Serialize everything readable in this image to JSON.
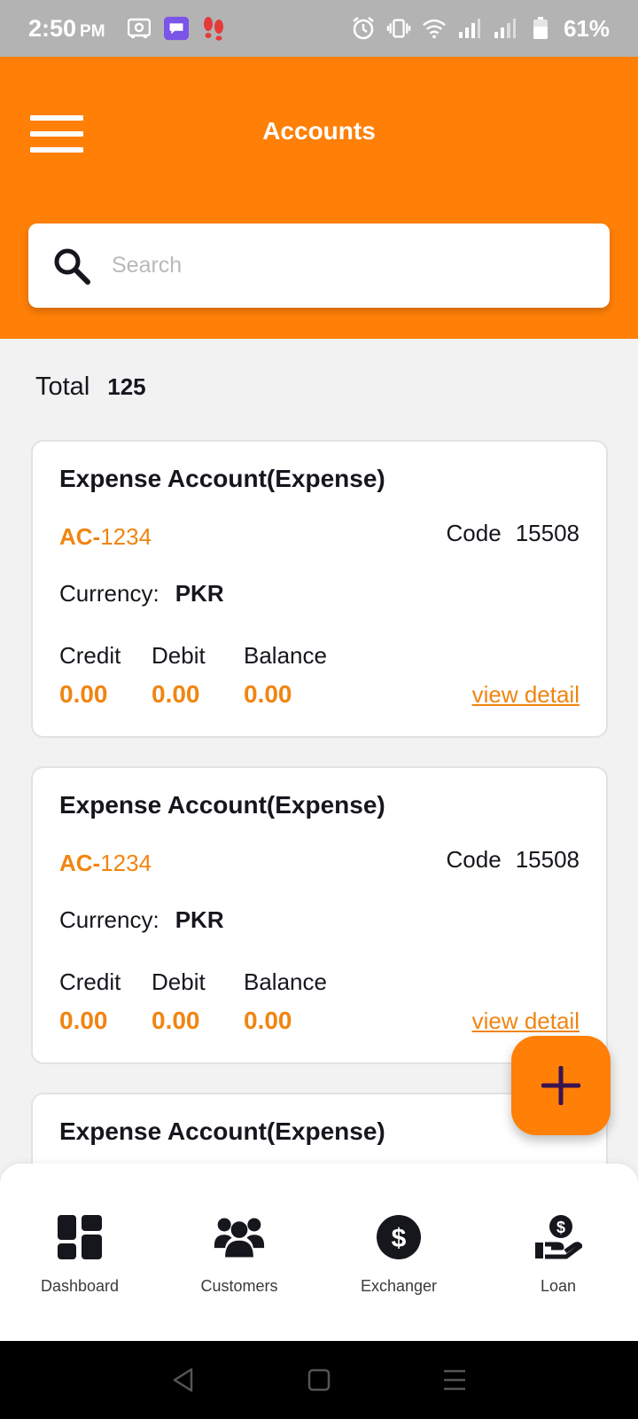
{
  "status_bar": {
    "time": "2:50",
    "ampm": "PM",
    "battery": "61%",
    "icons": [
      "cloud-save-icon",
      "chat-app-icon",
      "footsteps-icon",
      "alarm-icon",
      "vibrate-icon",
      "wifi-icon",
      "signal-icon",
      "signal-icon",
      "battery-icon"
    ]
  },
  "header": {
    "title": "Accounts",
    "menu_icon": "hamburger-menu-icon",
    "color": "#ff7f07"
  },
  "search": {
    "placeholder": "Search",
    "value": "",
    "icon": "search-icon"
  },
  "summary": {
    "total_label": "Total",
    "total_value": "125"
  },
  "accounts": [
    {
      "title": "Expense Account(Expense)",
      "ac_prefix": "AC-",
      "ac_number": "1234",
      "code_label": "Code",
      "code_value": "15508",
      "currency_label": "Currency:",
      "currency_value": "PKR",
      "credit_label": "Credit",
      "credit_value": "0.00",
      "debit_label": "Debit",
      "debit_value": "0.00",
      "balance_label": "Balance",
      "balance_value": "0.00",
      "link_label": "view detail"
    },
    {
      "title": "Expense Account(Expense)",
      "ac_prefix": "AC-",
      "ac_number": "1234",
      "code_label": "Code",
      "code_value": "15508",
      "currency_label": "Currency:",
      "currency_value": "PKR",
      "credit_label": "Credit",
      "credit_value": "0.00",
      "debit_label": "Debit",
      "debit_value": "0.00",
      "balance_label": "Balance",
      "balance_value": "0.00",
      "link_label": "view detail"
    },
    {
      "title": "Expense Account(Expense)"
    }
  ],
  "fab": {
    "icon": "plus-icon",
    "icon_color": "#3a1450"
  },
  "bottom_nav": [
    {
      "label": "Dashboard",
      "icon": "dashboard-icon"
    },
    {
      "label": "Customers",
      "icon": "customers-icon"
    },
    {
      "label": "Exchanger",
      "icon": "dollar-icon"
    },
    {
      "label": "Loan",
      "icon": "loan-icon"
    }
  ],
  "system_nav": [
    "back-icon",
    "home-icon",
    "recents-icon"
  ],
  "colors": {
    "accent": "#f08512",
    "text_dark": "#16161d",
    "background": "#f2f2f2"
  }
}
